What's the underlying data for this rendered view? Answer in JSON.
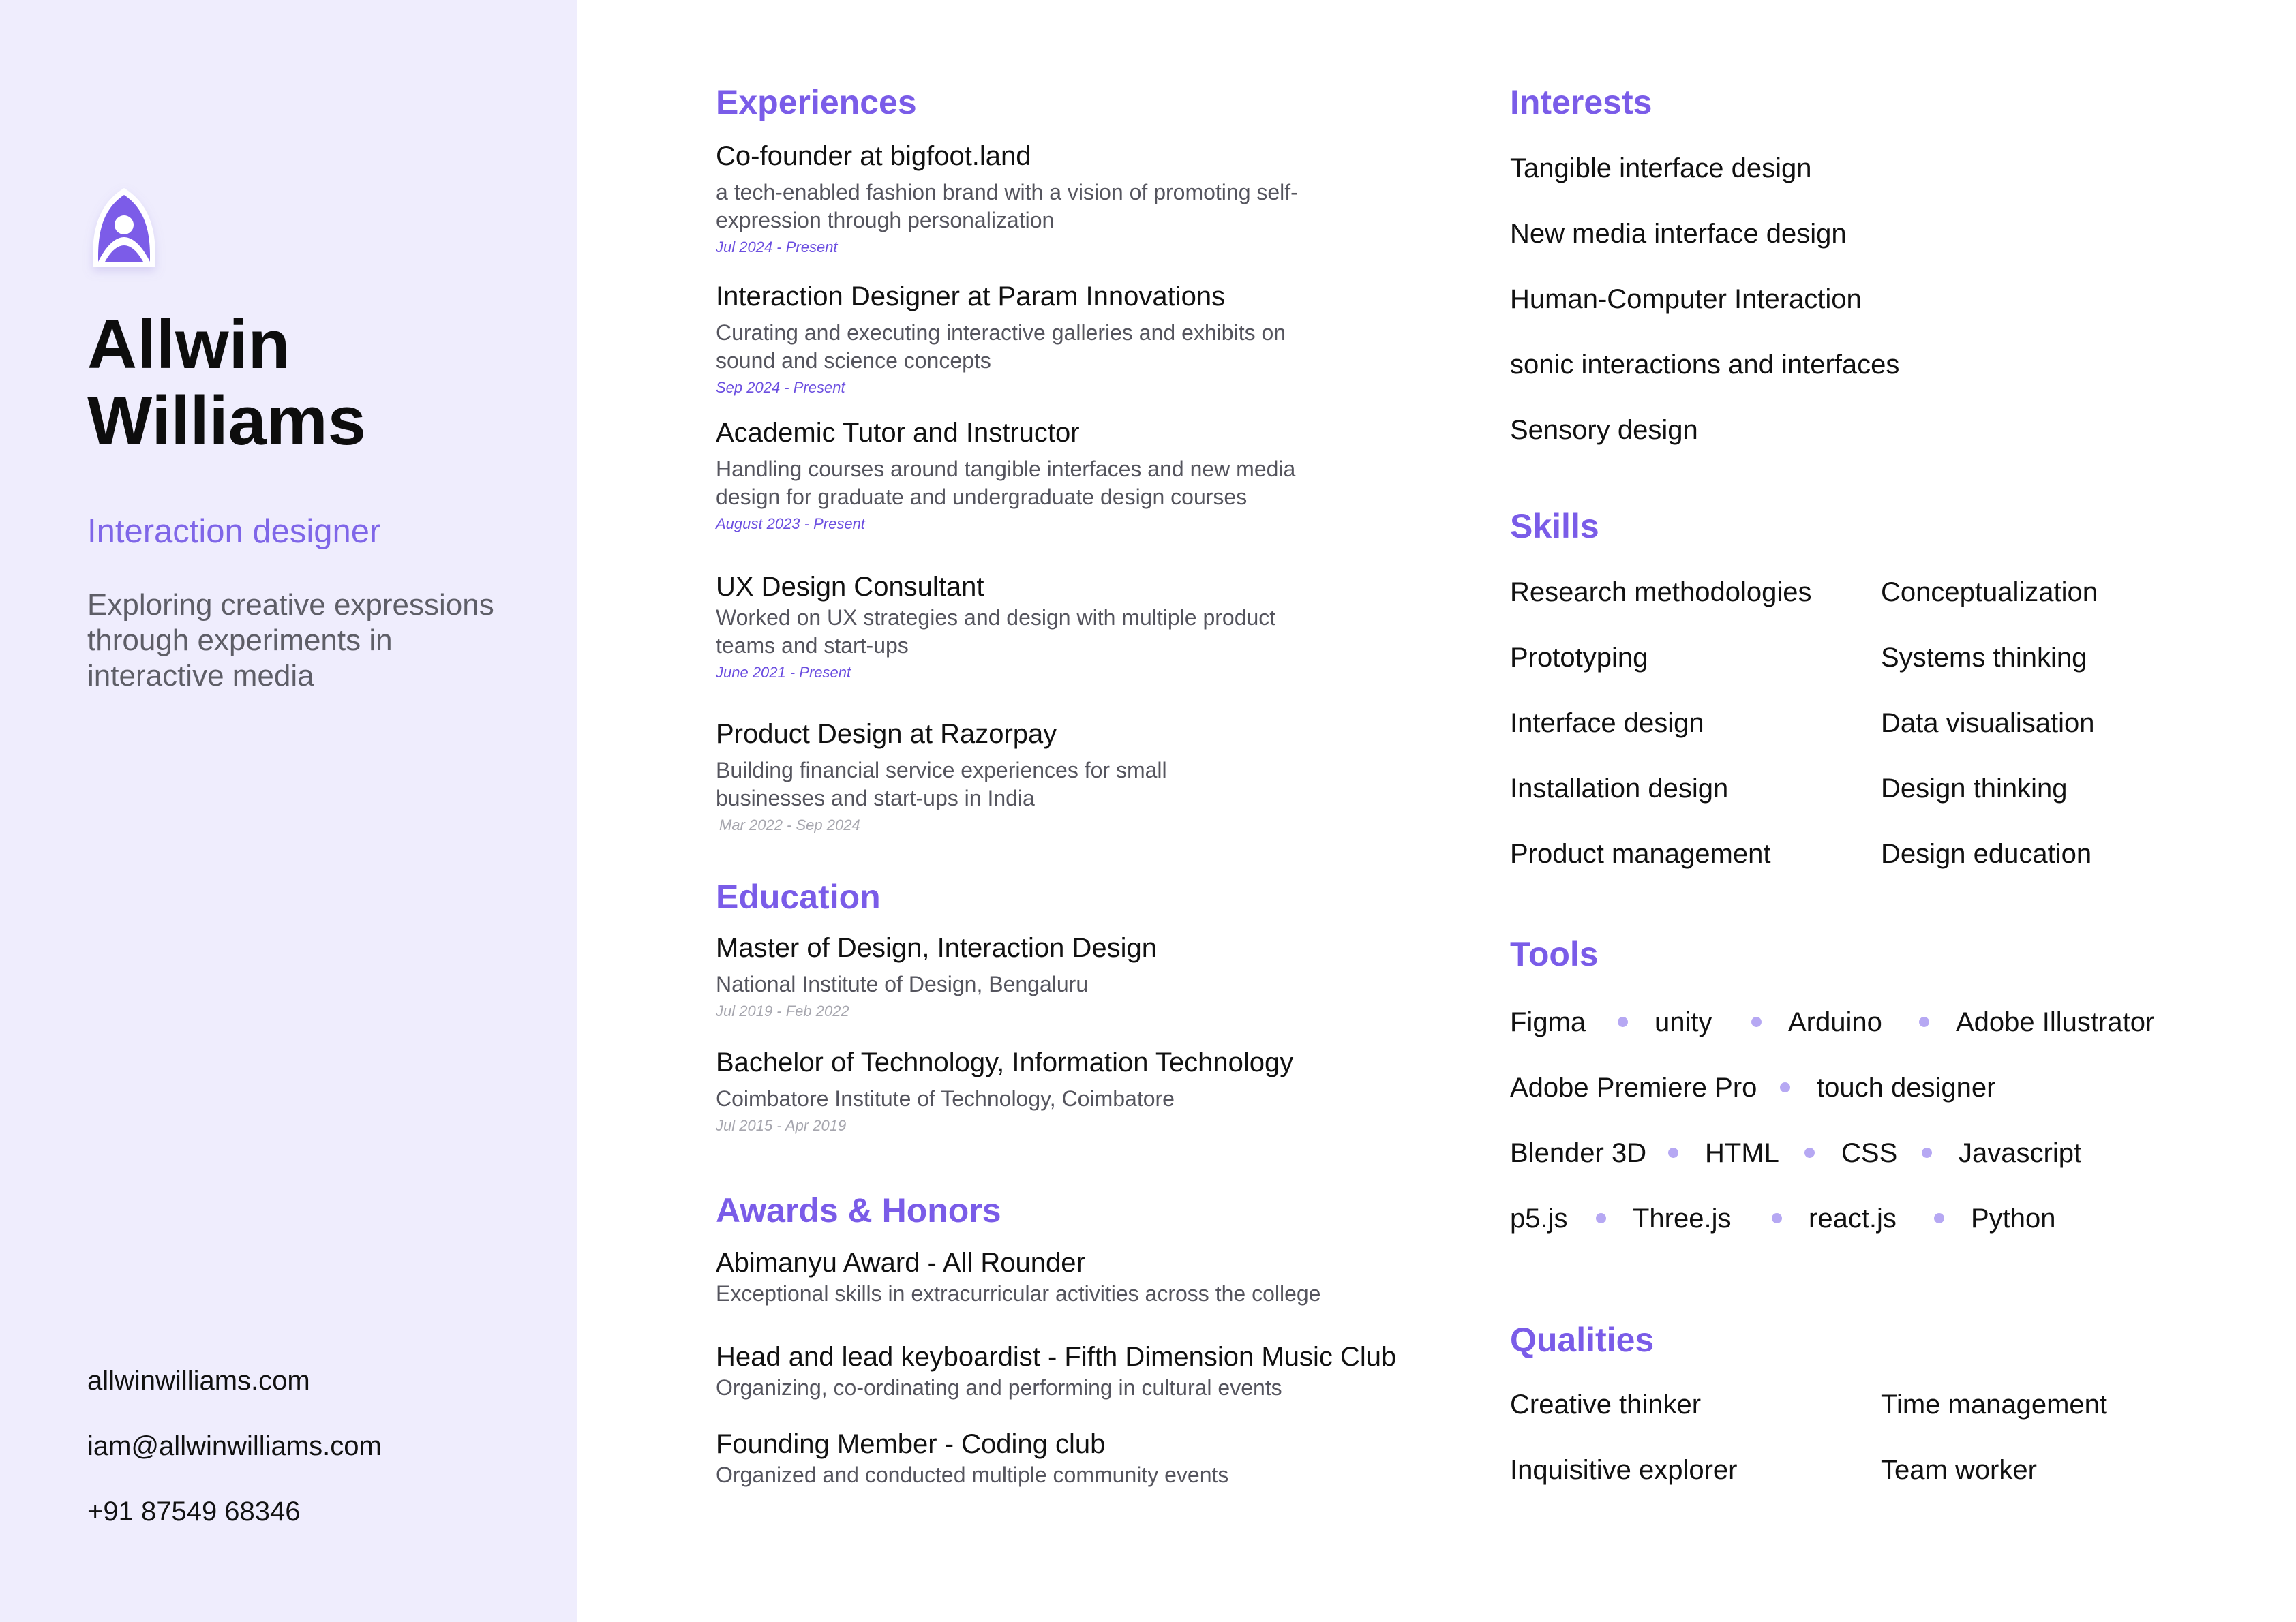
{
  "profile": {
    "name_line1": "Allwin",
    "name_line2": "Williams",
    "role": "Interaction designer",
    "bio": "Exploring creative expressions through experiments in interactive media",
    "logo_icon": "rocket-logo-icon",
    "contacts": [
      "allwinwilliams.com",
      "iam@allwinwilliams.com",
      "+91 87549 68346"
    ]
  },
  "colors": {
    "accent": "#7a5ce8",
    "sidebar_bg": "#efedfd",
    "dot": "#b6a8f3"
  },
  "experiences": {
    "heading": "Experiences",
    "items": [
      {
        "title": "Co-founder at bigfoot.land",
        "desc": "a tech-enabled fashion brand with a vision of promoting self-expression through personalization",
        "date": "Jul 2024 - Present"
      },
      {
        "title": "Interaction Designer at Param Innovations",
        "desc": "Curating and executing interactive galleries and exhibits on sound and science concepts",
        "date": "Sep 2024 - Present"
      },
      {
        "title": "Academic Tutor and Instructor",
        "desc": "Handling courses around tangible interfaces and new media design for graduate and undergraduate design courses",
        "date": "August 2023 - Present"
      },
      {
        "title": "UX Design Consultant",
        "desc": "Worked on UX strategies and design with multiple product teams and start-ups",
        "date": "June 2021 - Present"
      },
      {
        "title": "Product Design at Razorpay",
        "desc": "Building financial service experiences for small businesses and start-ups in India",
        "date": "Mar 2022 - Sep 2024"
      }
    ]
  },
  "education": {
    "heading": "Education",
    "items": [
      {
        "title": "Master of Design, Interaction Design",
        "desc": "National Institute of Design, Bengaluru",
        "date": "Jul 2019 - Feb 2022"
      },
      {
        "title": "Bachelor of Technology, Information Technology",
        "desc": "Coimbatore Institute of Technology, Coimbatore",
        "date": "Jul 2015 - Apr 2019"
      }
    ]
  },
  "awards": {
    "heading": "Awards & Honors",
    "items": [
      {
        "title": "Abimanyu Award - All Rounder",
        "desc": "Exceptional skills in extracurricular activities across the college"
      },
      {
        "title": "Head and lead keyboardist - Fifth Dimension Music Club",
        "desc": "Organizing, co-ordinating and performing in cultural events"
      },
      {
        "title": "Founding Member - Coding club",
        "desc": "Organized and conducted multiple community events"
      }
    ]
  },
  "interests": {
    "heading": "Interests",
    "items": [
      "Tangible interface design",
      "New media interface design",
      "Human-Computer Interaction",
      "sonic interactions and interfaces",
      "Sensory design"
    ]
  },
  "skills": {
    "heading": "Skills",
    "left": [
      "Research methodologies",
      "Prototyping",
      "Interface design",
      "Installation design",
      "Product management"
    ],
    "right": [
      "Conceptualization",
      "Systems thinking",
      "Data visualisation",
      "Design thinking",
      "Design education"
    ]
  },
  "tools": {
    "heading": "Tools",
    "rows": [
      [
        "Figma",
        "unity",
        "Arduino",
        "Adobe Illustrator"
      ],
      [
        "Adobe Premiere Pro",
        "touch designer"
      ],
      [
        "Blender 3D",
        "HTML",
        "CSS",
        "Javascript"
      ],
      [
        "p5.js",
        "Three.js",
        "react.js",
        "Python"
      ]
    ]
  },
  "qualities": {
    "heading": "Qualities",
    "left": [
      "Creative thinker",
      "Inquisitive explorer"
    ],
    "right": [
      "Time management",
      "Team worker"
    ]
  }
}
